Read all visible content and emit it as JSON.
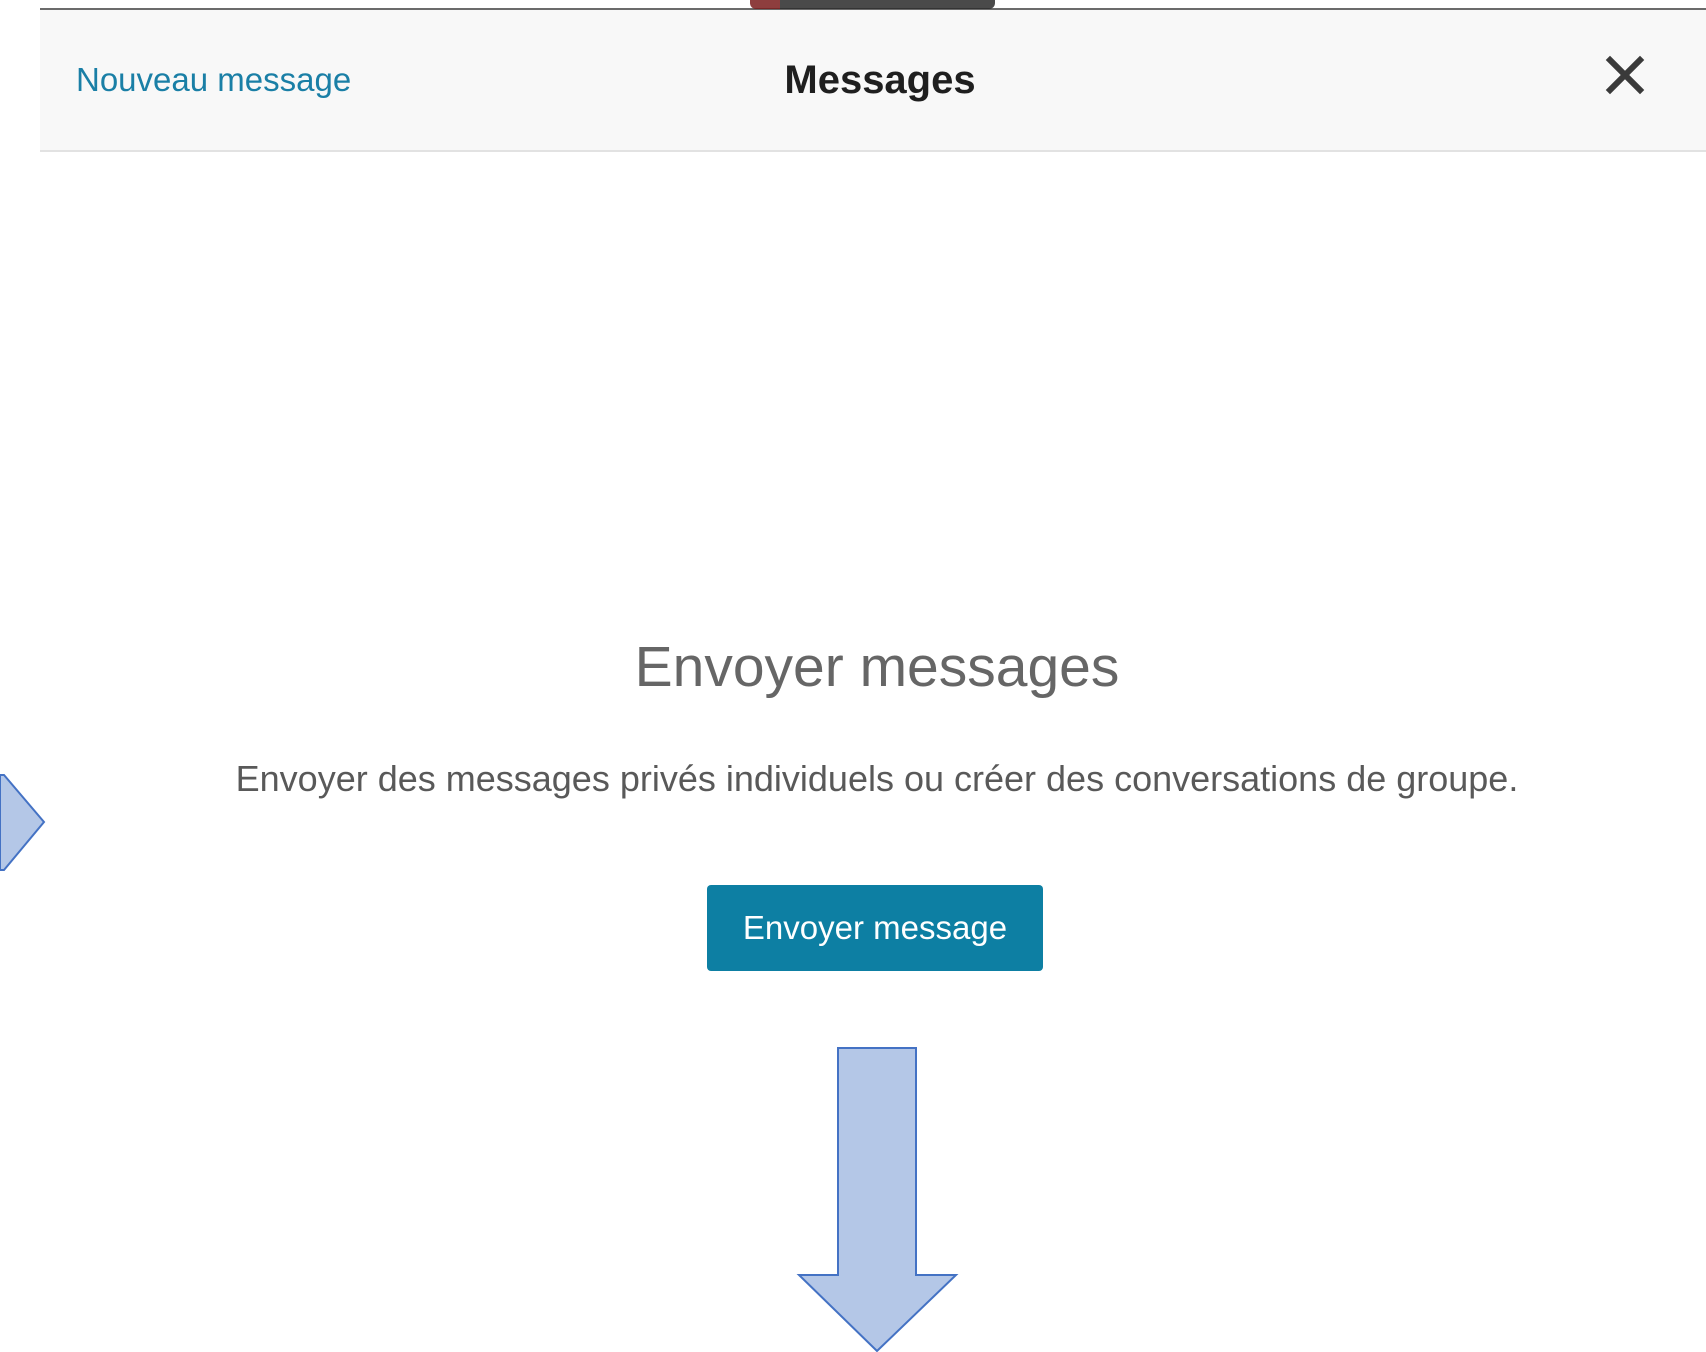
{
  "header": {
    "new_message_label": "Nouveau message",
    "title": "Messages",
    "close_icon": "close-icon"
  },
  "empty_state": {
    "title": "Envoyer messages",
    "description": "Envoyer des messages privés individuels ou créer des conversations de groupe.",
    "send_button_label": "Envoyer message"
  },
  "colors": {
    "link": "#1a7fa6",
    "button_bg": "#0d7fa3",
    "header_bg": "#f8f8f8",
    "annotation_fill": "#b4c7e7",
    "annotation_stroke": "#4472c4"
  },
  "annotations": {
    "arrow_down_icon": "arrow-down-icon",
    "chevron_right_icon": "chevron-right-icon"
  }
}
